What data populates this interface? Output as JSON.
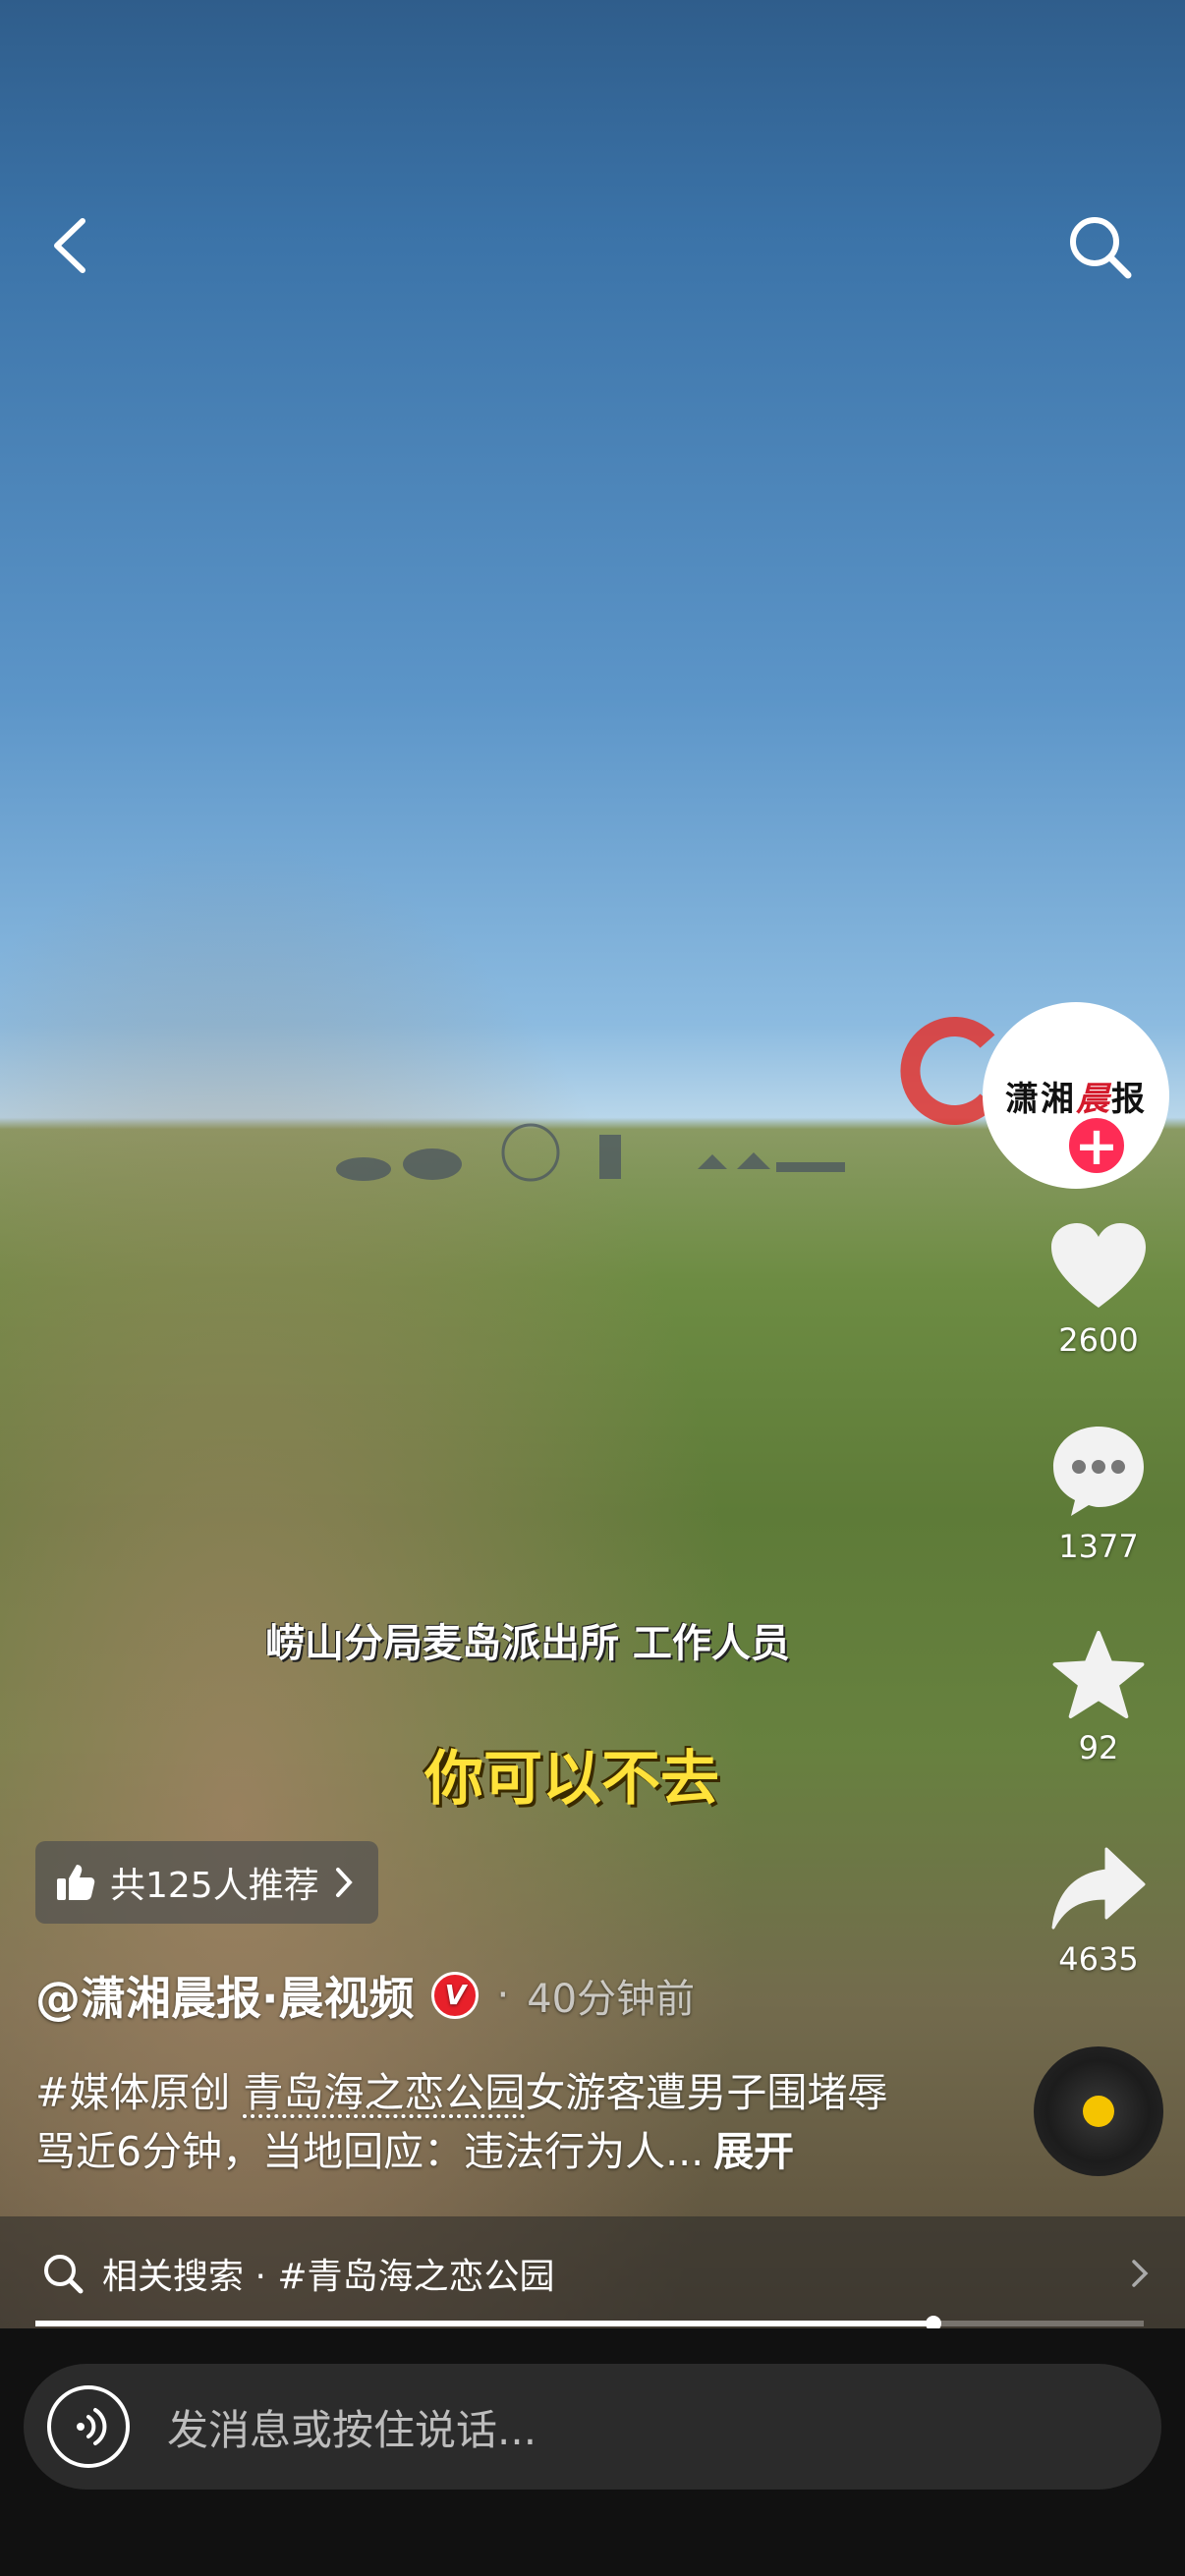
{
  "video": {
    "subtitle_top": "崂山分局麦岛派出所 工作人员",
    "subtitle_main": "你可以不去"
  },
  "actions": {
    "likes": "2600",
    "comments": "1377",
    "favorites": "92",
    "shares": "4635"
  },
  "avatar": {
    "text_a": "潇湘",
    "text_b": "晨",
    "text_c": "报"
  },
  "recommend": {
    "label": "共125人推荐"
  },
  "author": {
    "name": "@潇湘晨报·晨视频",
    "verified_badge": "V",
    "separator": "·",
    "time": "40分钟前"
  },
  "description": {
    "tag": "#媒体原创",
    "link": "青岛海之恋公园",
    "text": "女游客遭男子围堵辱骂近6分钟，当地回应：违法行为人...",
    "more": "展开"
  },
  "related_search": {
    "text": "相关搜索 · #青岛海之恋公园"
  },
  "progress": {
    "fraction": 0.81
  },
  "message_bar": {
    "placeholder": "发消息或按住说话..."
  },
  "colors": {
    "like_red": "#fe2c55",
    "subtitle_yellow": "#ffe23a",
    "music_dot": "#f5c400"
  }
}
